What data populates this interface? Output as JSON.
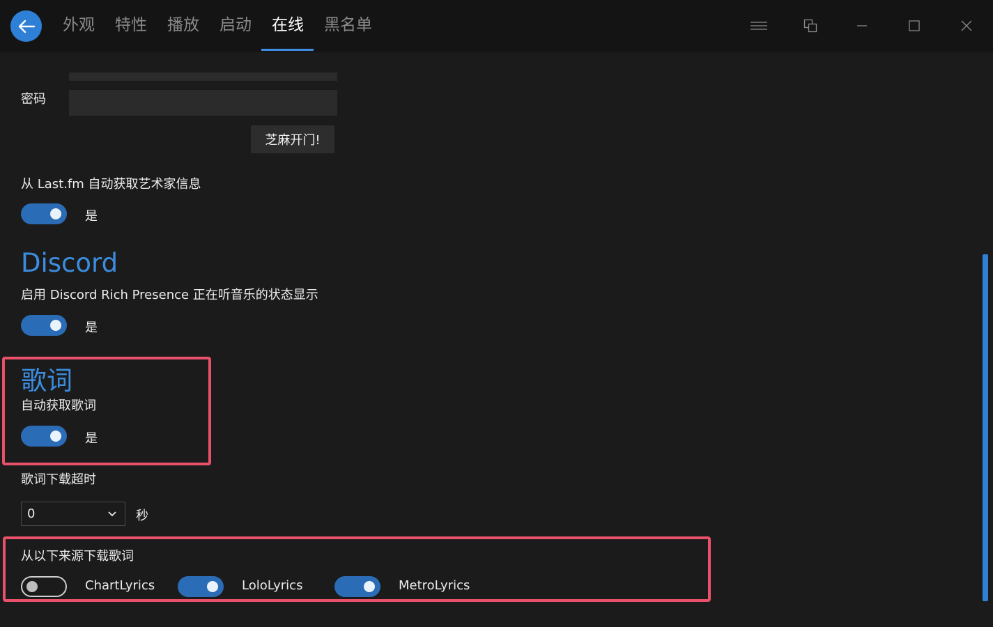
{
  "tabs": [
    {
      "label": "外观"
    },
    {
      "label": "特性"
    },
    {
      "label": "播放"
    },
    {
      "label": "启动"
    },
    {
      "label": "在线"
    },
    {
      "label": "黑名单"
    }
  ],
  "active_tab": "在线",
  "password": {
    "label": "密码",
    "value": ""
  },
  "username": {
    "value": ""
  },
  "login_button": "芝麻开门!",
  "lastfm": {
    "label": "从 Last.fm 自动获取艺术家信息",
    "toggle_state": "是",
    "on": true
  },
  "discord": {
    "title": "Discord",
    "label": "启用 Discord Rich Presence 正在听音乐的状态显示",
    "toggle_state": "是",
    "on": true
  },
  "lyrics": {
    "title": "歌词",
    "auto_label": "自动获取歌词",
    "toggle_state": "是",
    "on": true,
    "timeout_label": "歌词下载超时",
    "timeout_value": "0",
    "timeout_unit": "秒",
    "sources_label": "从以下来源下载歌词",
    "sources": [
      {
        "name": "ChartLyrics",
        "on": false
      },
      {
        "name": "LoloLyrics",
        "on": true
      },
      {
        "name": "MetroLyrics",
        "on": true
      }
    ]
  },
  "colors": {
    "accent": "#2e7fd6",
    "highlight_border": "#e9506a",
    "background": "#1b1b1b"
  }
}
